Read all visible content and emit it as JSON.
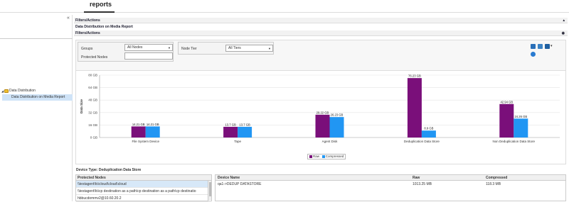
{
  "header": {
    "title": "reports"
  },
  "sidebar": {
    "collapse_glyph": "«",
    "tree": {
      "parent_label": "Data Distribution",
      "child_label": "Data Distribution on Media Report"
    }
  },
  "main": {
    "filters_actions_title": "Filters/Actions",
    "report_title": "Data Distribution on Media Report",
    "filters_subtitle": "Filters/Actions",
    "filters": {
      "groups_label": "Groups",
      "groups_value": "All Nodes",
      "protected_nodes_label": "Protected Nodes",
      "protected_nodes_value": "",
      "node_tier_label": "Node Tier",
      "node_tier_value": "All Tiers"
    },
    "device_type_title": "Device Type: Deduplication Data Store",
    "protected_nodes_header": "Protected Nodes",
    "protected_nodes": [
      "\\\\testagent\\fs\\cloud\\cloud\\cloud",
      "\\\\testagent\\fs\\cp destination as a path\\cp destination as a path\\cp destinatio",
      "hbbucdommv2@10.60.20.2"
    ],
    "device_table": {
      "headers": {
        "device_name": "Device Name",
        "raw": "Raw",
        "compressed": "Compressed"
      },
      "rows": [
        {
          "device_name": "qa1->DEDUP DATASTORE",
          "raw": "1013.25 MB",
          "compressed": "118.3 MB"
        }
      ]
    }
  },
  "colors": {
    "raw": "#7a0f7a",
    "compressed": "#2196f3",
    "selection": "#d7e8f8"
  },
  "chart_data": {
    "type": "bar",
    "ylabel": "Data Size",
    "ylim": [
      0,
      80
    ],
    "y_ticks": [
      "80 GB",
      "64 GB",
      "48 GB",
      "32 GB",
      "16 GB",
      "0 GB"
    ],
    "categories": [
      "File System Device",
      "Tape",
      "Agent Disk",
      "Deduplication Data Store",
      "Non Deduplication Data Store"
    ],
    "series": [
      {
        "name": "Raw",
        "values": [
          14.21,
          13.7,
          29.22,
          76.23,
          42.94
        ],
        "labels": [
          "14.21 GB",
          "13.7 GB",
          "29.22 GB",
          "76.23 GB",
          "42.94 GB"
        ]
      },
      {
        "name": "Compressed",
        "values": [
          14.21,
          13.7,
          26.23,
          8.9,
          24.26
        ],
        "labels": [
          "14.21 GB",
          "13.7 GB",
          "26.23 GB",
          "8.9 GB",
          "24.26 GB"
        ]
      }
    ],
    "grid": true,
    "legend": "bottom-center"
  }
}
